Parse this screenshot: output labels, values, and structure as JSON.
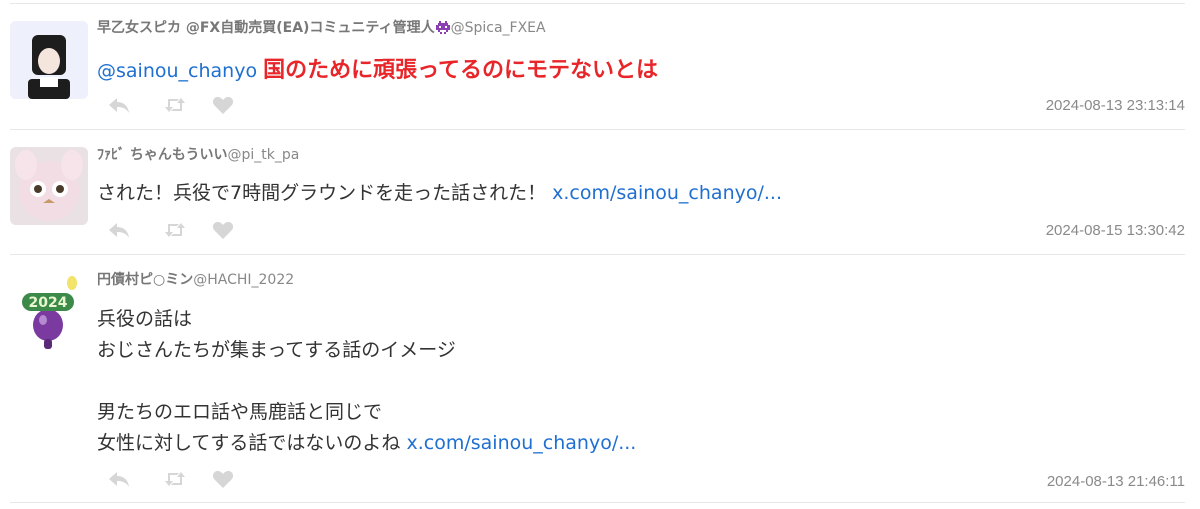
{
  "tweets": [
    {
      "display_name": "早乙女スピカ @FX自動売買(EA)コミュニティ管理人",
      "handle": "@Spica_FXEA",
      "mention": "@sainou_chanyo",
      "text": "国のために頑張ってるのにモテないとは",
      "timestamp": "2024-08-13 23:13:14"
    },
    {
      "display_name": "ﾌｧﾋﾞ ちゃんもういい",
      "handle": "@pi_tk_pa",
      "text": "された！兵役で7時間グラウンドを走った話された！",
      "link": "x.com/sainou_chanyo/...",
      "timestamp": "2024-08-15 13:30:42"
    },
    {
      "display_name": "円債村ピ○ミン",
      "handle": "@HACHI_2022",
      "lines": [
        "兵役の話は",
        "おじさんたちが集まってする話のイメージ",
        "",
        "男たちのエロ話や馬鹿話と同じで",
        "女性に対してする話ではないのよね"
      ],
      "link": "x.com/sainou_chanyo/...",
      "timestamp": "2024-08-13 21:46:11"
    }
  ],
  "icons": [
    "reply-icon",
    "retweet-icon",
    "like-icon"
  ],
  "colors": {
    "link": "#1f6fd1",
    "highlight": "#e8262a",
    "muted": "#8a8a8a",
    "icon": "#d6d6d6"
  }
}
